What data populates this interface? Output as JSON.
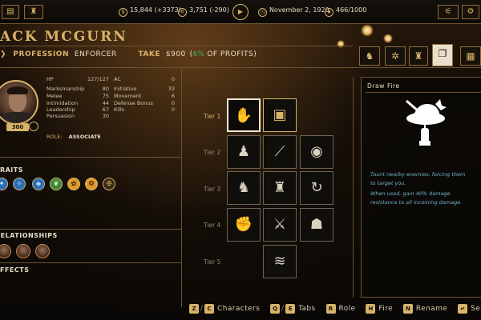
{
  "topbar": {
    "money": "15,844 (+3373)",
    "goods": "3,751 (-290)",
    "date": "November 2, 1920",
    "heat": "466/1000"
  },
  "character": {
    "name": "ACK MCGURN",
    "profession_label": "PROFESSION",
    "profession": "ENFORCER",
    "take_label": "TAKE",
    "take_amount": "$900",
    "take_open": "(",
    "take_pct": "6%",
    "take_suffix": " OF PROFITS)",
    "level": "300",
    "role_label": "ROLE:",
    "role": "ASSOCIATE"
  },
  "stats_left": [
    {
      "label": "HP",
      "value": "127/127"
    },
    {
      "label": "Marksmanship",
      "value": "80"
    },
    {
      "label": "Melee",
      "value": "75"
    },
    {
      "label": "Intimidation",
      "value": "44"
    },
    {
      "label": "Leadership",
      "value": "67"
    },
    {
      "label": "Persuasion",
      "value": "30"
    }
  ],
  "stats_right": [
    {
      "label": "AC",
      "value": "0"
    },
    {
      "label": "Initiative",
      "value": "33"
    },
    {
      "label": "Movement",
      "value": "6"
    },
    {
      "label": "Defense Bonus",
      "value": "0"
    },
    {
      "label": "Kills",
      "value": "0"
    }
  ],
  "sections": {
    "traits": "TRAITS",
    "relationships": "RELATIONSHIPS",
    "effects": "EFFECTS"
  },
  "traits_icons": [
    "trait-blue-icon",
    "trait-blue-icon",
    "trait-blue-icon",
    "trait-green-icon",
    "trait-orange-icon",
    "trait-orange-icon",
    "trait-gold-icon"
  ],
  "tiers": [
    "Tier 1",
    "Tier 2",
    "Tier 3",
    "Tier 4",
    "Tier 5"
  ],
  "detail": {
    "title": "Draw Fire",
    "line1": "Taunt nearby enemies, forcing them",
    "line2": "to target you.",
    "line3": "When used, gain 40% damage",
    "line4": "resistance to all incoming damage."
  },
  "bottom_keys": {
    "k1": "Z",
    "k2": "C",
    "characters": "Characters",
    "k3": "Q",
    "k4": "E",
    "tabs": "Tabs",
    "k5": "R",
    "role": "Role",
    "k6": "H",
    "fire": "Fire",
    "k7": "N",
    "rename": "Rename",
    "k8": "↵",
    "select": "Select"
  },
  "colors": {
    "gold": "#d8b36a",
    "highlight_green": "#3fb36a",
    "description_blue": "#6fb3cf"
  }
}
